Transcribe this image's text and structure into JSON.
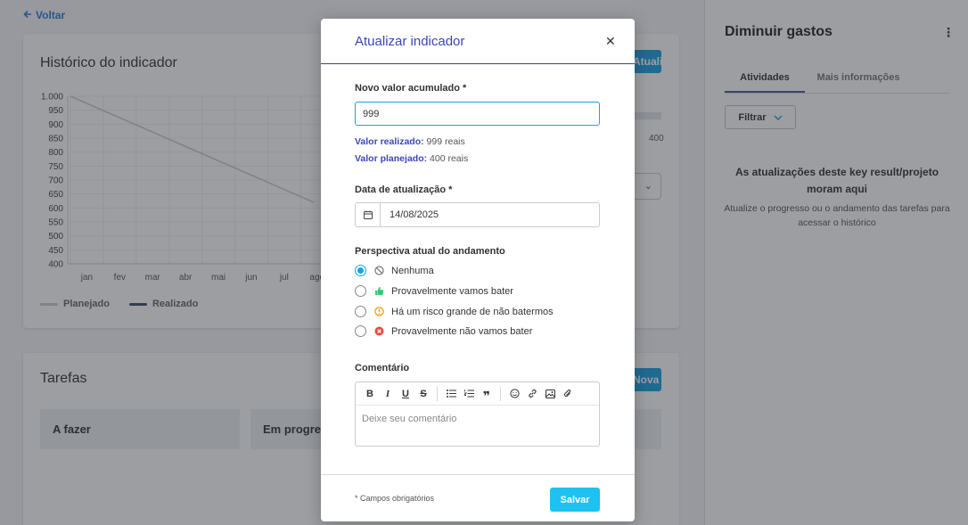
{
  "page": {
    "back_label": "Voltar",
    "history_title": "Histórico do indicador",
    "update_button_label": "Atualizar",
    "progress_max": "400",
    "tasks_title": "Tarefas",
    "new_task_label": "Nova tarefa",
    "task_columns": [
      "A fazer",
      "Em progresso"
    ]
  },
  "chart_data": {
    "type": "line",
    "categories": [
      "jan",
      "fev",
      "mar",
      "abr",
      "mai",
      "jun",
      "jul",
      "ago"
    ],
    "y_ticks": [
      "1.000",
      "950",
      "900",
      "850",
      "800",
      "750",
      "700",
      "650",
      "600",
      "550",
      "500",
      "450",
      "400"
    ],
    "ylim": [
      400,
      1000
    ],
    "series": [
      {
        "name": "Planejado",
        "color": "#cccccc",
        "x": [
          0,
          7.4
        ],
        "values": [
          1000,
          620
        ]
      },
      {
        "name": "Realizado",
        "color": "#3b4a6b",
        "values": []
      }
    ],
    "grid": true,
    "legend": "bottom-left"
  },
  "right_panel": {
    "title": "Diminuir gastos",
    "tabs": [
      {
        "label": "Atividades",
        "active": true
      },
      {
        "label": "Mais informações",
        "active": false
      }
    ],
    "filter_label": "Filtrar",
    "empty_title": "As atualizações deste key result/projeto moram aqui",
    "empty_desc": "Atualize o progresso ou o andamento das tarefas para acessar o histórico"
  },
  "modal": {
    "title": "Atualizar indicador",
    "value_label": "Novo valor acumulado *",
    "value_input": "999",
    "realized_label": "Valor realizado:",
    "realized_value": "999 reais",
    "planned_label": "Valor planejado:",
    "planned_value": "400 reais",
    "date_label": "Data de atualização *",
    "date_value": "14/08/2025",
    "perspective_label": "Perspectiva atual do andamento",
    "options": [
      {
        "label": "Nenhuma",
        "icon": "ban-icon",
        "checked": true
      },
      {
        "label": "Provavelmente vamos bater",
        "icon": "thumbs-up-icon",
        "checked": false
      },
      {
        "label": "Há um risco grande de não batermos",
        "icon": "alert-icon",
        "checked": false
      },
      {
        "label": "Provavelmente não vamos bater",
        "icon": "x-circle-icon",
        "checked": false
      }
    ],
    "comment_label": "Comentário",
    "comment_placeholder": "Deixe seu comentário",
    "required_note": "* Campos obrigatórios",
    "save_label": "Salvar"
  },
  "colors": {
    "accent": "#1aa3e0",
    "title_blue": "#3b47b6",
    "success": "#2ecc71",
    "warning": "#f39c12",
    "danger": "#e74c3c"
  }
}
